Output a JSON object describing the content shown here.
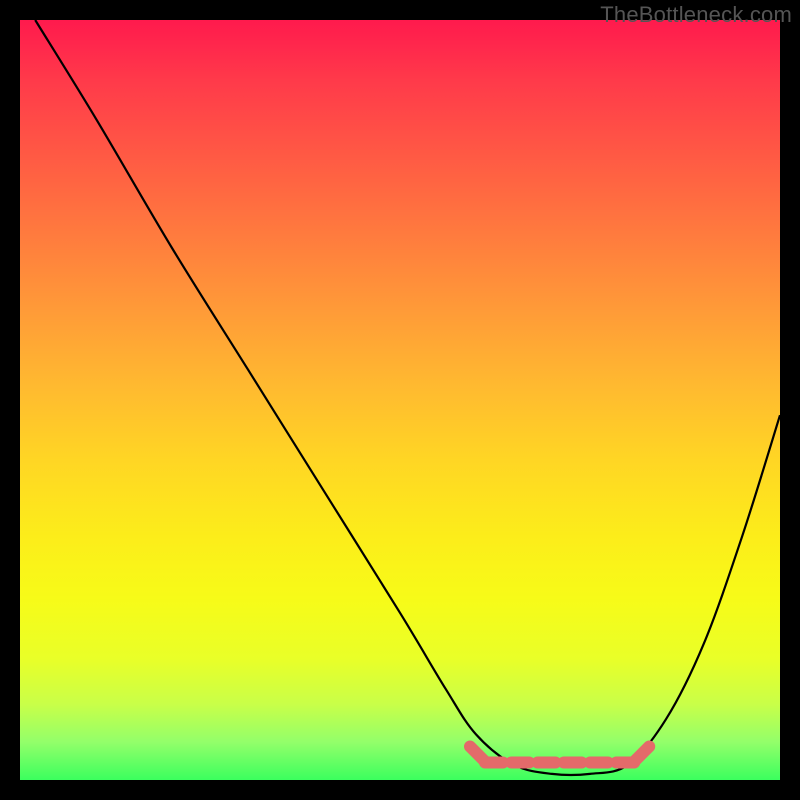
{
  "watermark": "TheBottleneck.com",
  "colors": {
    "curve": "#000000",
    "pink_marker": "#e46a6a",
    "gradient_top": "#ff1a4d",
    "gradient_bottom": "#3bff5e",
    "frame": "#000000"
  },
  "chart_data": {
    "type": "line",
    "title": "",
    "xlabel": "",
    "ylabel": "",
    "xlim": [
      0,
      100
    ],
    "ylim": [
      0,
      100
    ],
    "grid": false,
    "legend": false,
    "series": [
      {
        "name": "bottleneck-curve",
        "x": [
          2,
          10,
          20,
          30,
          40,
          50,
          56,
          60,
          65,
          70,
          75,
          80,
          85,
          90,
          95,
          100
        ],
        "y": [
          100,
          87,
          70,
          54,
          38,
          22,
          12,
          6,
          2,
          0.8,
          0.8,
          2,
          8,
          18,
          32,
          48
        ]
      }
    ],
    "annotations": [
      {
        "name": "optimal-range-marker",
        "x_start": 60,
        "x_end": 82,
        "y": 0.8,
        "color": "#e46a6a"
      }
    ]
  }
}
